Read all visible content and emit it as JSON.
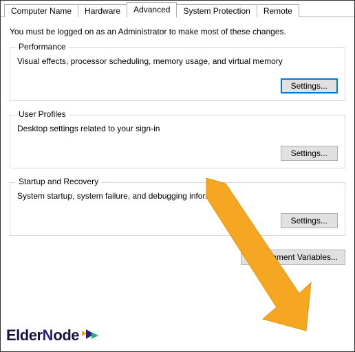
{
  "tabs": {
    "computer_name": "Computer Name",
    "hardware": "Hardware",
    "advanced": "Advanced",
    "system_protection": "System Protection",
    "remote": "Remote"
  },
  "info_text": "You must be logged on as an Administrator to make most of these changes.",
  "performance": {
    "legend": "Performance",
    "desc": "Visual effects, processor scheduling, memory usage, and virtual memory",
    "button": "Settings..."
  },
  "user_profiles": {
    "legend": "User Profiles",
    "desc": "Desktop settings related to your sign-in",
    "button": "Settings..."
  },
  "startup_recovery": {
    "legend": "Startup and Recovery",
    "desc": "System startup, system failure, and debugging information",
    "button": "Settings..."
  },
  "env_button": "Environment Variables...",
  "logo": {
    "part1": "Elder",
    "part2": "N",
    "part3": "ode"
  },
  "arrow_color": "#f5a623"
}
